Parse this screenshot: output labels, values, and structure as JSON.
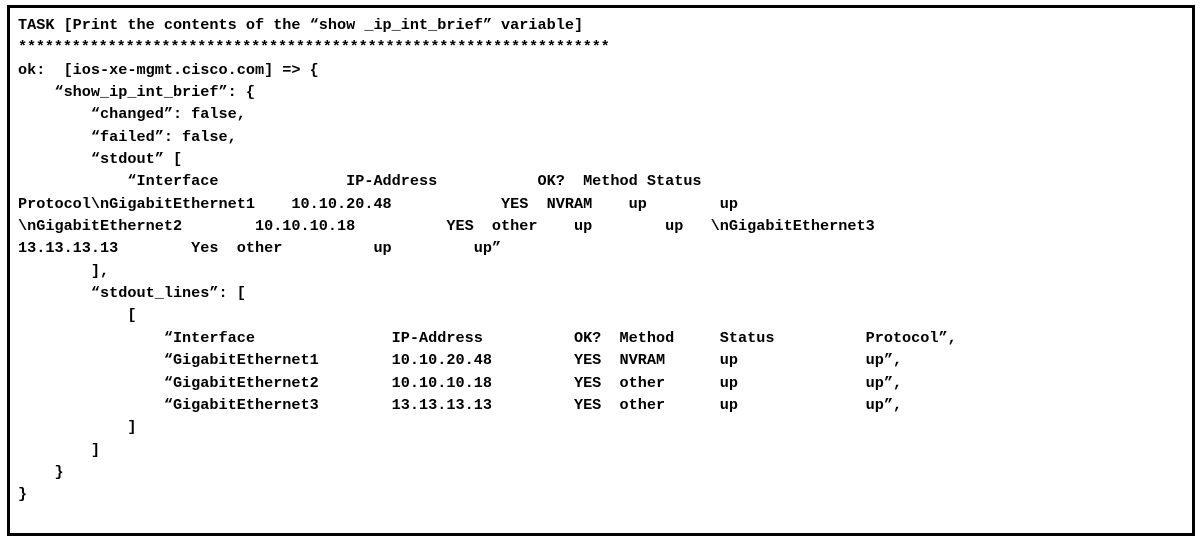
{
  "window": {
    "kind": "terminal-console-output",
    "border_color": "#000000",
    "background_color": "#ffffff",
    "text_color": "#000000"
  },
  "console": {
    "task_header": "TASK [Print the contents of the “show _ip_int_brief” variable]",
    "separator": "******************************************************************",
    "lines": [
      "TASK [Print the contents of the “show _ip_int_brief” variable]",
      "******************************************************************",
      "ok:  [ios-xe-mgmt.cisco.com] => {",
      "    “show_ip_int_brief”: {",
      "        “changed”: false,",
      "        “failed”: false,",
      "        “stdout” [",
      "            “Interface              IP-Address           OK?  Method Status",
      "Protocol\\nGigabitEthernet1    10.10.20.48            YES  NVRAM    up        up",
      "\\nGigabitEthernet2        10.10.10.18          YES  other    up        up   \\nGigabitEthernet3",
      "13.13.13.13        Yes  other          up         up”",
      "        ],",
      "        “stdout_lines”: [",
      "            [",
      "                “Interface               IP-Address          OK?  Method     Status          Protocol”,",
      "                “GigabitEthernet1        10.10.20.48         YES  NVRAM      up              up”,",
      "                “GigabitEthernet2        10.10.10.18         YES  other      up              up”,",
      "                “GigabitEthernet3        13.13.13.13         YES  other      up              up”,",
      "            ]",
      "        ]",
      "    }",
      "}"
    ],
    "host": "ios-xe-mgmt.cisco.com",
    "status_prefix": "ok:",
    "variable_name": "show_ip_int_brief",
    "fields": {
      "changed": "false",
      "failed": "false"
    },
    "table": {
      "headers": [
        "Interface",
        "IP-Address",
        "OK?",
        "Method",
        "Status",
        "Protocol"
      ],
      "rows": [
        [
          "GigabitEthernet1",
          "10.10.20.48",
          "YES",
          "NVRAM",
          "up",
          "up"
        ],
        [
          "GigabitEthernet2",
          "10.10.10.18",
          "YES",
          "other",
          "up",
          "up"
        ],
        [
          "GigabitEthernet3",
          "13.13.13.13",
          "YES",
          "other",
          "up",
          "up"
        ]
      ]
    }
  }
}
